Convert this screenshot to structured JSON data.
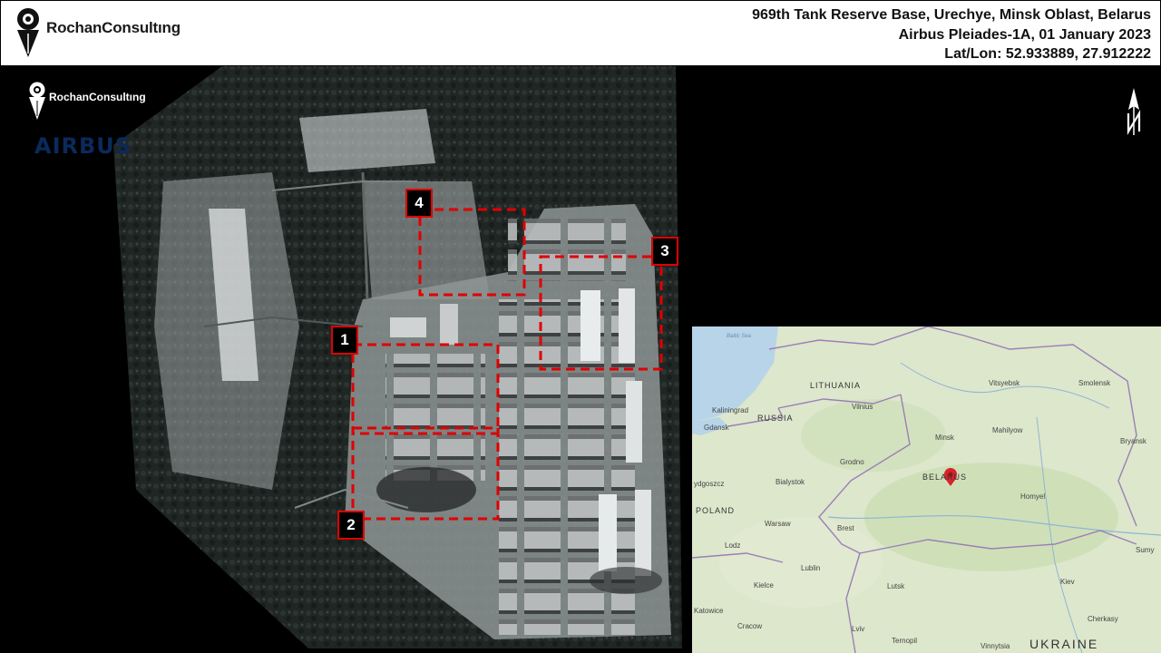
{
  "header": {
    "brand": "RochanConsultıng",
    "title_line1": "969th Tank Reserve Base, Urechye, Minsk Oblast, Belarus",
    "title_line2": "Airbus Pleiades-1A, 01 January 2023",
    "title_line3": "Lat/Lon:  52.933889, 27.912222"
  },
  "watermark": {
    "brand": "RochanConsultıng",
    "provider": "AIRBUS"
  },
  "callouts": [
    "1",
    "2",
    "3",
    "4"
  ],
  "inset_map": {
    "labels": {
      "baltic_sea": "Baltic Sea",
      "lithuania": "LITHUANIA",
      "kaliningrad": "Kaliningrad",
      "russia": "RUSSIA",
      "gdansk": "Gdansk",
      "vilnius": "Vilnius",
      "vitsyebsk": "Vitsyebsk",
      "smolensk": "Smolensk",
      "minsk": "Minsk",
      "mahilyow": "Mahilyow",
      "bryansk": "Bryansk",
      "grodno": "Grodno",
      "bydgoszcz": "ydgoszcz",
      "bialystok": "Bialystok",
      "belarus": "BELARUS",
      "homyel": "Homyel",
      "poland": "POLAND",
      "warsaw": "Warsaw",
      "brest": "Brest",
      "lodz": "Lodz",
      "sumy": "Sumy",
      "lublin": "Lublin",
      "kielce": "Kielce",
      "lutsk": "Lutsk",
      "kiev": "Kiev",
      "katowice": "Katowice",
      "cracow": "Cracow",
      "cherkasy": "Cherkasy",
      "lviv": "Lviv",
      "ternopil": "Ternopil",
      "vinnytsia": "Vinnytsia",
      "ukraine": "UKRAINE"
    }
  },
  "colors": {
    "callout_border": "#e00000",
    "dashed_box": "#e00000",
    "map_pin": "#d8232a"
  }
}
